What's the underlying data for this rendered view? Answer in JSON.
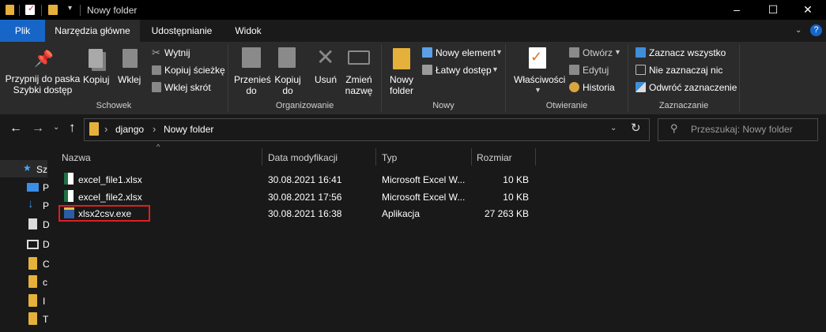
{
  "window": {
    "title": "Nowy folder"
  },
  "tabs": [
    "Plik",
    "Narzędzia główne",
    "Udostępnianie",
    "Widok"
  ],
  "ribbon": {
    "pin": [
      "Przypnij do paska",
      "Szybki dostęp"
    ],
    "copy": "Kopiuj",
    "paste": "Wklej",
    "cut": "Wytnij",
    "copy_path": "Kopiuj ścieżkę",
    "paste_shortcut": "Wklej skrót",
    "group_schowek": "Schowek",
    "move_to": [
      "Przenieś",
      "do"
    ],
    "copy_to": [
      "Kopiuj",
      "do"
    ],
    "delete": "Usuń",
    "rename": [
      "Zmień",
      "nazwę"
    ],
    "group_organizowanie": "Organizowanie",
    "new_folder": [
      "Nowy",
      "folder"
    ],
    "new_item": "Nowy element",
    "easy_access": "Łatwy dostęp",
    "group_nowy": "Nowy",
    "properties": "Właściwości",
    "open": "Otwórz",
    "edit": "Edytuj",
    "history": "Historia",
    "group_otwieranie": "Otwieranie",
    "select_all": "Zaznacz wszystko",
    "select_none": "Nie zaznaczaj nic",
    "invert": "Odwróć zaznaczenie",
    "group_zaznaczanie": "Zaznaczanie"
  },
  "address": {
    "segments": [
      "django",
      "Nowy folder"
    ]
  },
  "search": {
    "placeholder": "Przeszukaj: Nowy folder"
  },
  "columns": [
    "Nazwa",
    "Data modyfikacji",
    "Typ",
    "Rozmiar"
  ],
  "files": [
    {
      "name": "excel_file1.xlsx",
      "date": "30.08.2021 16:41",
      "type": "Microsoft Excel W...",
      "size": "10 KB"
    },
    {
      "name": "excel_file2.xlsx",
      "date": "30.08.2021 17:56",
      "type": "Microsoft Excel W...",
      "size": "10 KB"
    },
    {
      "name": "xlsx2csv.exe",
      "date": "30.08.2021 16:38",
      "type": "Aplikacja",
      "size": "27 263 KB"
    }
  ],
  "nav_pane": {
    "quick_access": "Sz",
    "items": [
      "P",
      "P",
      "D",
      "D",
      "C",
      "c",
      "I",
      "T"
    ]
  }
}
